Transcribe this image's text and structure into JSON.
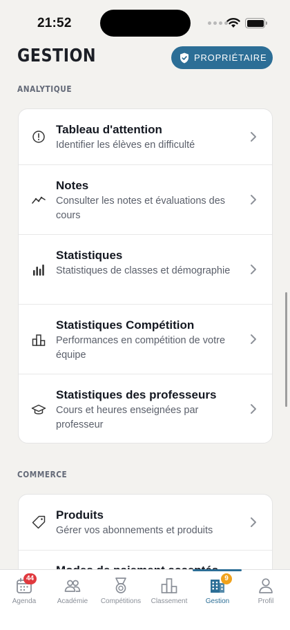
{
  "status_bar": {
    "time": "21:52"
  },
  "header": {
    "title": "GESTION",
    "role_badge": "PROPRIÉTAIRE"
  },
  "sections": [
    {
      "label": "ANALYTIQUE",
      "items": [
        {
          "icon": "alert-circle-icon",
          "title": "Tableau d'attention",
          "description": "Identifier les élèves en difficulté"
        },
        {
          "icon": "trend-line-icon",
          "title": "Notes",
          "description": "Consulter les notes et évaluations des cours"
        },
        {
          "icon": "bar-chart-icon",
          "title": "Statistiques",
          "description": "Statistiques de classes et démographie"
        },
        {
          "icon": "podium-icon",
          "title": "Statistiques Compétition",
          "description": "Performances en compétition de votre équipe"
        },
        {
          "icon": "graduation-cap-icon",
          "title": "Statistiques des professeurs",
          "description": "Cours et heures enseignées par professeur"
        }
      ]
    },
    {
      "label": "COMMERCE",
      "items": [
        {
          "icon": "tag-icon",
          "title": "Produits",
          "description": "Gérer vos abonnements et produits"
        },
        {
          "icon": "card-icon",
          "title": "Modes de paiement acceptés",
          "description": ""
        }
      ]
    }
  ],
  "tabbar": {
    "items": [
      {
        "label": "Agenda",
        "icon": "calendar-icon",
        "badge": "44"
      },
      {
        "label": "Académie",
        "icon": "people-icon"
      },
      {
        "label": "Compétitions",
        "icon": "medal-icon"
      },
      {
        "label": "Classement",
        "icon": "ranking-icon"
      },
      {
        "label": "Gestion",
        "icon": "building-icon",
        "badge": "9",
        "active": true
      },
      {
        "label": "Profil",
        "icon": "person-icon"
      }
    ]
  },
  "colors": {
    "accent": "#2c6e96",
    "badge_red": "#e0393e",
    "badge_orange": "#f0a21c",
    "background": "#f3f2ef"
  }
}
